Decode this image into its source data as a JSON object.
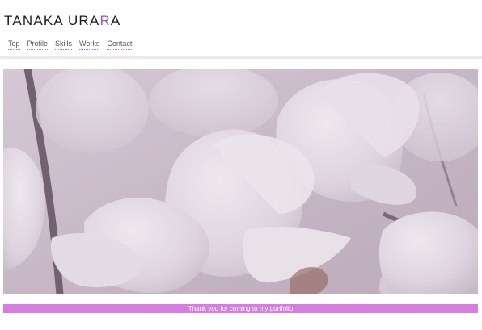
{
  "site": {
    "title_before": "TANAKA URA",
    "title_accent": "R",
    "title_after": "A"
  },
  "nav": {
    "items": [
      {
        "label": "Top"
      },
      {
        "label": "Profile"
      },
      {
        "label": "Skills"
      },
      {
        "label": "Works"
      },
      {
        "label": "Contact"
      }
    ]
  },
  "hero": {
    "image_subject": "magnolia-flowers"
  },
  "footer": {
    "message": "Thank you for coming to my portfolio"
  },
  "colors": {
    "accent": "#9b59b6",
    "footer_bar": "#d57ee0",
    "hero_overlay": "#cbbccb"
  }
}
